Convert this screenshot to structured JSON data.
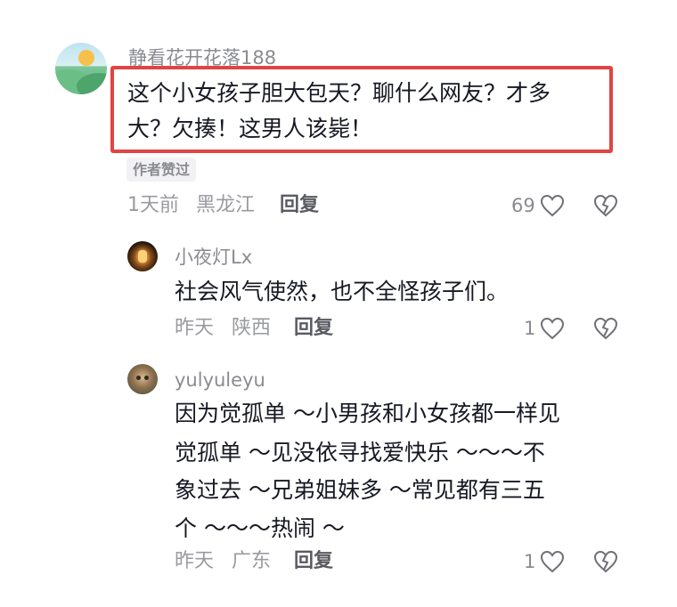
{
  "comments": [
    {
      "username": "静看花开花落188",
      "text_line1": "这个小女孩子胆大包天？聊什么网友？才多",
      "text_line2": "大？欠揍！这男人该毙！",
      "badge": "作者赞过",
      "time": "1天前",
      "location": "黑龙江",
      "reply": "回复",
      "likes": "69"
    },
    {
      "username": "小夜灯Lx",
      "text_line1": "社会风气使然，也不全怪孩子们。",
      "time": "昨天",
      "location": "陕西",
      "reply": "回复",
      "likes": "1"
    },
    {
      "username": "yulyuleyu",
      "text_line1": "因为觉孤单 ～小男孩和小女孩都一样见",
      "text_line2": "觉孤单 ～见没依寻找爱快乐 ～～～不",
      "text_line3": "象过去 ～兄弟姐妹多 ～常见都有三五",
      "text_line4": "个 ～～～热闹 ～",
      "time": "昨天",
      "location": "广东",
      "reply": "回复",
      "likes": "1"
    }
  ],
  "colors": {
    "highlight_border": "#e04444",
    "text_primary": "#161823",
    "text_secondary": "#8a8b91"
  },
  "icons": [
    "heart-icon",
    "broken-heart-icon"
  ]
}
